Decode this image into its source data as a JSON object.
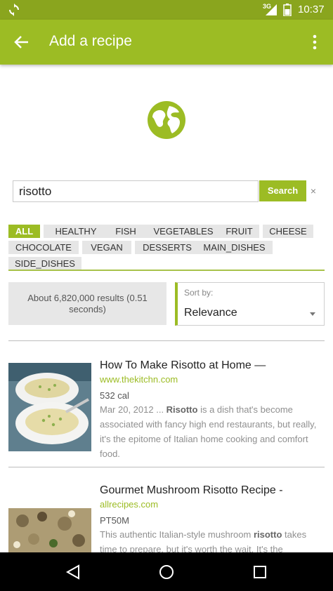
{
  "status_bar": {
    "network": "3G",
    "time": "10:37"
  },
  "app_bar": {
    "title": "Add a recipe"
  },
  "search": {
    "value": "risotto",
    "button_label": "Search",
    "clear_label": "×"
  },
  "tags": [
    "ALL",
    "HEALTHY",
    "FISH",
    "VEGETABLES",
    "FRUIT",
    "CHEESE",
    "CHOCOLATE",
    "VEGAN",
    "DESSERTS",
    "MAIN_DISHES",
    "SIDE_DISHES"
  ],
  "active_tag": "ALL",
  "results": {
    "summary": "About 6,820,000 results (0.51 seconds)"
  },
  "sort": {
    "label": "Sort by:",
    "value": "Relevance"
  },
  "recipes": [
    {
      "title": "How To Make Risotto at Home —",
      "source": "www.thekitchn.com",
      "meta": "532 cal",
      "snippet_pre": "Mar 20, 2012 ... ",
      "snippet_bold": "Risotto",
      "snippet_post": " is a dish that's become associated with fancy high end restaurants, but really, it's the epitome of Italian home cooking and comfort food."
    },
    {
      "title": "Gourmet Mushroom Risotto Recipe -",
      "source": "allrecipes.com",
      "meta": "PT50M",
      "snippet_pre": "This authentic Italian-style mushroom ",
      "snippet_bold": "risotto",
      "snippet_post": " takes time to prepare, but it's worth the wait. It's the"
    }
  ],
  "colors": {
    "accent": "#9cbc24",
    "status_bar": "#8aa51e"
  },
  "icons": {
    "status_left": "sync-icon",
    "back": "arrow-back-icon",
    "menu": "overflow-menu-icon",
    "globe": "globe-icon"
  }
}
